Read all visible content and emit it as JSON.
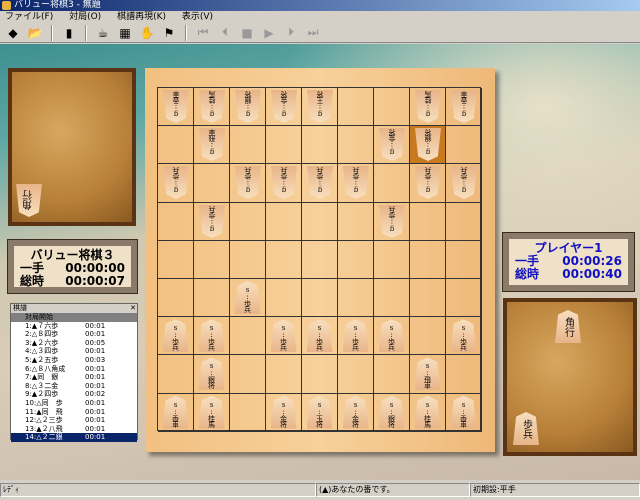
{
  "window": {
    "title": "バリュー将棋3 - 無題"
  },
  "menu": [
    "ファイル(F)",
    "対局(O)",
    "棋譜再現(K)",
    "表示(V)"
  ],
  "toolbar": {
    "buttons": [
      {
        "icon": "new-game-icon",
        "glyph": "◆",
        "enabled": true
      },
      {
        "icon": "open-folder-icon",
        "glyph": "📂",
        "enabled": true
      },
      {
        "icon": "save-icon",
        "glyph": "▮",
        "enabled": true
      },
      {
        "icon": "tea-cup-icon",
        "glyph": "☕",
        "enabled": true
      },
      {
        "icon": "board-icon",
        "glyph": "▦",
        "enabled": true
      },
      {
        "icon": "hand-icon",
        "glyph": "✋",
        "enabled": true
      },
      {
        "icon": "flag-icon",
        "glyph": "⚑",
        "enabled": true
      }
    ],
    "playback": [
      {
        "icon": "first-icon",
        "glyph": "⏮"
      },
      {
        "icon": "prev-icon",
        "glyph": "⏴"
      },
      {
        "icon": "stop-icon",
        "glyph": "■"
      },
      {
        "icon": "play-icon",
        "glyph": "▶"
      },
      {
        "icon": "next-icon",
        "glyph": "⏵"
      },
      {
        "icon": "last-icon",
        "glyph": "⏭"
      }
    ]
  },
  "gote_info": {
    "name": "バリュー将棋３",
    "move_label": "一手",
    "move_time": "00:00:00",
    "total_label": "総時",
    "total_time": "00:00:07"
  },
  "sente_info": {
    "name": "プレイヤー1",
    "move_label": "一手",
    "move_time": "00:00:26",
    "total_label": "総時",
    "total_time": "00:00:40"
  },
  "gote_hand": [
    "角行"
  ],
  "sente_hand": [
    "角行",
    "歩兵"
  ],
  "board": [
    [
      "g:香車",
      "g:桂馬",
      "g:銀将",
      "g:金将",
      "g:王将",
      "",
      "",
      "g:桂馬",
      "g:香車"
    ],
    [
      "",
      "g:飛車",
      "",
      "",
      "",
      "",
      "g:金将",
      "g:銀将",
      ""
    ],
    [
      "g:歩兵",
      "",
      "g:歩兵",
      "g:歩兵",
      "g:歩兵",
      "g:歩兵",
      "",
      "g:歩兵",
      "g:歩兵"
    ],
    [
      "",
      "g:歩兵",
      "",
      "",
      "",
      "",
      "g:歩兵",
      "",
      ""
    ],
    [
      "",
      "",
      "",
      "",
      "",
      "",
      "",
      "",
      ""
    ],
    [
      "",
      "",
      "s:歩兵",
      "",
      "",
      "",
      "",
      "",
      ""
    ],
    [
      "s:歩兵",
      "s:歩兵",
      "",
      "s:歩兵",
      "s:歩兵",
      "s:歩兵",
      "s:歩兵",
      "",
      "s:歩兵"
    ],
    [
      "",
      "s:銀将",
      "",
      "",
      "",
      "",
      "",
      "s:飛車",
      ""
    ],
    [
      "s:香車",
      "s:桂馬",
      "",
      "s:金将",
      "s:玉将",
      "s:金将",
      "s:銀将",
      "s:桂馬",
      "s:香車"
    ]
  ],
  "last_move_square": "2二",
  "colors": {
    "highlight": "#c87a20",
    "info_text_gote": "#000000",
    "info_text_sente": "#1010c0",
    "selection": "#0a246a"
  },
  "movelist": {
    "title": "棋譜",
    "header": "対局開始",
    "selected_index": 13,
    "moves": [
      {
        "move": "1:▲７六歩",
        "time": "00:01"
      },
      {
        "move": "2:△８四歩",
        "time": "00:01"
      },
      {
        "move": "3:▲２六歩",
        "time": "00:05"
      },
      {
        "move": "4:△３四歩",
        "time": "00:01"
      },
      {
        "move": "5:▲２五歩",
        "time": "00:03"
      },
      {
        "move": "6:△８八角成",
        "time": "00:01"
      },
      {
        "move": "7:▲同　銀",
        "time": "00:01"
      },
      {
        "move": "8:△３二金",
        "time": "00:01"
      },
      {
        "move": "9:▲２四歩",
        "time": "00:02"
      },
      {
        "move": "10:△同　歩",
        "time": "00:01"
      },
      {
        "move": "11:▲同　飛",
        "time": "00:01"
      },
      {
        "move": "12:△２三歩",
        "time": "00:01"
      },
      {
        "move": "13:▲２八飛",
        "time": "00:01"
      },
      {
        "move": "14:△２二銀",
        "time": "00:01"
      }
    ]
  },
  "status": {
    "left": "ﾚﾃﾞｨ",
    "middle": "(▲)あなたの番です。",
    "right": "初期設:平手"
  }
}
